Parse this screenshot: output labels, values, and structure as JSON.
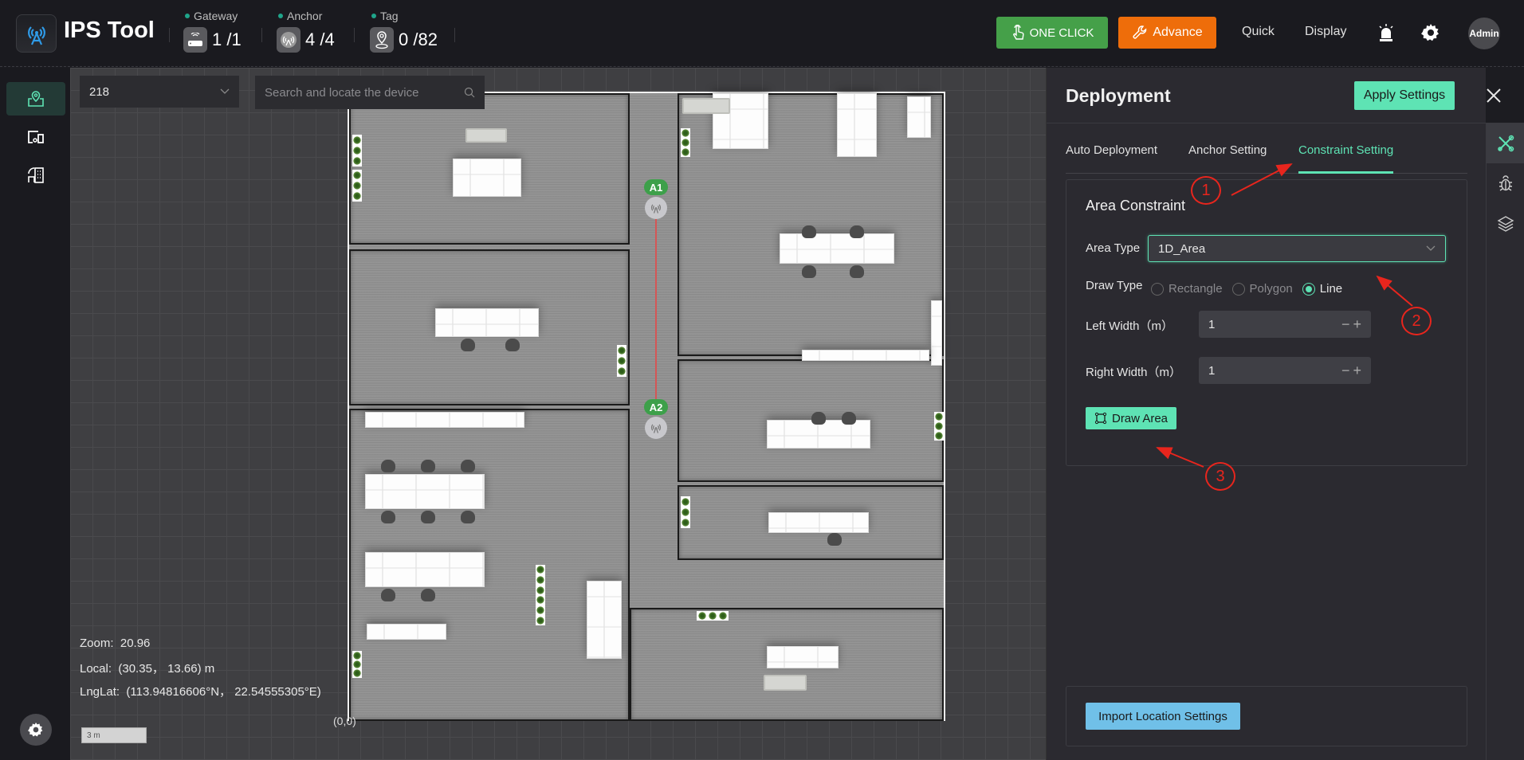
{
  "header": {
    "app_title": "IPS Tool",
    "stats": [
      {
        "label": "Gateway",
        "value": "1 /1",
        "icon": "router-icon"
      },
      {
        "label": "Anchor",
        "value": "4 /4",
        "icon": "anchor-icon"
      },
      {
        "label": "Tag",
        "value": "0 /82",
        "icon": "location-tag-icon"
      }
    ],
    "one_click_label": "ONE CLICK",
    "advance_label": "Advance",
    "quick_label": "Quick",
    "display_label": "Display",
    "avatar_label": "Admin"
  },
  "sidebar": {
    "items": [
      {
        "name": "map-location",
        "active": true
      },
      {
        "name": "devices",
        "active": false
      },
      {
        "name": "buildings",
        "active": false
      }
    ]
  },
  "map": {
    "floor_value": "218",
    "search_placeholder": "Search and locate the device",
    "anchors": [
      {
        "label": "A1"
      },
      {
        "label": "A2"
      }
    ],
    "zoom_label": "Zoom:",
    "zoom_value": "20.96",
    "local_label": "Local:",
    "local_value": "(30.35， 13.66)  m",
    "lnglat_label": "LngLat:",
    "lnglat_value": "(113.94816606°N， 22.54555305°E)",
    "origin_label": "(0,0)",
    "scale_label": "3 m"
  },
  "panel": {
    "title": "Deployment",
    "apply_label": "Apply Settings",
    "tabs": [
      {
        "label": "Auto Deployment",
        "active": false
      },
      {
        "label": "Anchor Setting",
        "active": false
      },
      {
        "label": "Constraint Setting",
        "active": true
      }
    ],
    "area_constraint": {
      "title": "Area Constraint",
      "area_type_label": "Area Type",
      "area_type_value": "1D_Area",
      "draw_type_label": "Draw Type",
      "draw_types": [
        {
          "label": "Rectangle",
          "checked": false
        },
        {
          "label": "Polygon",
          "checked": false
        },
        {
          "label": "Line",
          "checked": true
        }
      ],
      "left_width_label": "Left Width（m）",
      "left_width_value": "1",
      "right_width_label": "Right Width（m）",
      "right_width_value": "1",
      "draw_area_label": "Draw Area"
    },
    "import_label": "Import Location Settings"
  },
  "right_rail": {
    "items": [
      {
        "name": "tools",
        "active": true
      },
      {
        "name": "debug",
        "active": false
      },
      {
        "name": "layers",
        "active": false
      }
    ]
  },
  "annotations": [
    "1",
    "2",
    "3"
  ],
  "colors": {
    "accent": "#5ee3b4",
    "one_click": "#45a049",
    "advance": "#ee6d0a",
    "import": "#70c0e8",
    "anchor_tag": "#3da04a",
    "annotation": "#e8251d"
  }
}
